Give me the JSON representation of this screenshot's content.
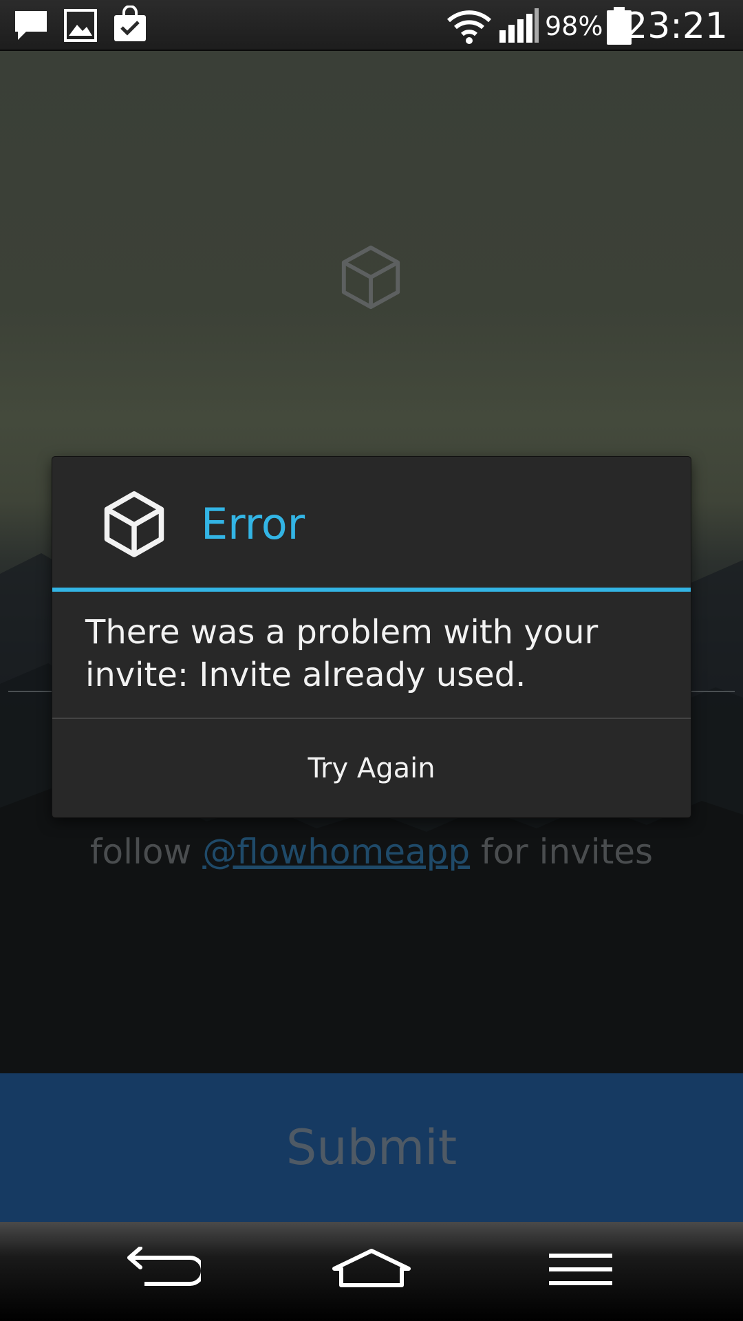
{
  "status_bar": {
    "notifications": [
      "chat-icon",
      "image-icon",
      "shopping-bag-icon"
    ],
    "battery_percent": "98%",
    "time": "23:21"
  },
  "main": {
    "follow_prefix": "follow ",
    "follow_handle": "@flowhomeapp",
    "follow_suffix": " for invites",
    "submit_label": "Submit"
  },
  "dialog": {
    "title": "Error",
    "message": "There was a problem with your invite: Invite already used.",
    "button_label": "Try Again"
  },
  "nav_bar": {
    "buttons": [
      "back-icon",
      "home-icon",
      "menu-icon"
    ]
  },
  "colors": {
    "accent": "#33b5e5",
    "submit_bg": "#163a62",
    "dialog_bg": "#282828"
  }
}
